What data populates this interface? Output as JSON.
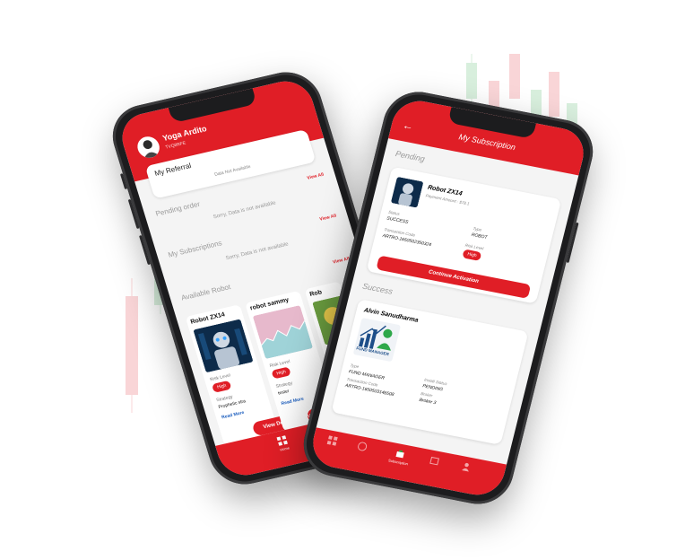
{
  "colors": {
    "accent": "#e01e26",
    "link": "#1d5fbf",
    "muted": "#9a9a9a"
  },
  "left_phone": {
    "user": {
      "name": "Yoga Ardito",
      "subtitle": "TVQ8RFE"
    },
    "referral": {
      "title": "My Referral",
      "empty": "Data Not Available"
    },
    "pending": {
      "title": "Pending order",
      "view_all": "View All",
      "empty": "Sorry, Data is not available"
    },
    "subscriptions": {
      "title": "My Subscriptions",
      "view_all": "View All",
      "empty": "Sorry, Data is not available"
    },
    "available": {
      "title": "Available Robot",
      "view_all": "View All"
    },
    "robots": [
      {
        "name": "Robot ZX14",
        "risk_label": "Risk Level",
        "risk": "High",
        "strategy_label": "Strategy",
        "strategy": "Prophetic stra",
        "read_more": "Read More",
        "button": "View Detail"
      },
      {
        "name": "robot sammy",
        "risk_label": "Risk Level",
        "risk": "High",
        "strategy_label": "Strategy",
        "strategy": "tester",
        "read_more": "Read More",
        "button": "View Detail"
      },
      {
        "name": "Rob"
      }
    ],
    "nav": [
      {
        "label": "Home",
        "icon": "home-icon"
      },
      {
        "label": "",
        "icon": "globe-icon"
      },
      {
        "label": "",
        "icon": "cart-icon"
      }
    ]
  },
  "right_phone": {
    "title": "My Subscription",
    "pending_title": "Pending",
    "pending_item": {
      "name": "Robot ZX14",
      "payment": "Payment Amount : $78.1",
      "status_label": "Status",
      "status": "SUCCESS",
      "type_label": "Type",
      "type": "ROBOT",
      "code_label": "Transaction Code",
      "code": "ARTRO-1650502350324",
      "risk_label": "Risk Level",
      "risk": "High",
      "button": "Continue Activation"
    },
    "success_title": "Success",
    "success_item": {
      "name": "Alvin Sanudharma",
      "image_text": "FUND MANAGER",
      "type_label": "Type",
      "type": "FUND MANAGER",
      "install_label": "Install Status",
      "install": "PENDING",
      "code_label": "Transaction Code",
      "code": "ARTRO-1650503146508",
      "broker_label": "Broker",
      "broker": "Broker 3"
    },
    "nav": [
      {
        "label": "",
        "icon": "home-icon"
      },
      {
        "label": "",
        "icon": "globe-icon"
      },
      {
        "label": "Subscription",
        "icon": "subscription-icon"
      },
      {
        "label": "",
        "icon": "calendar-icon"
      },
      {
        "label": "",
        "icon": "user-icon"
      }
    ]
  }
}
